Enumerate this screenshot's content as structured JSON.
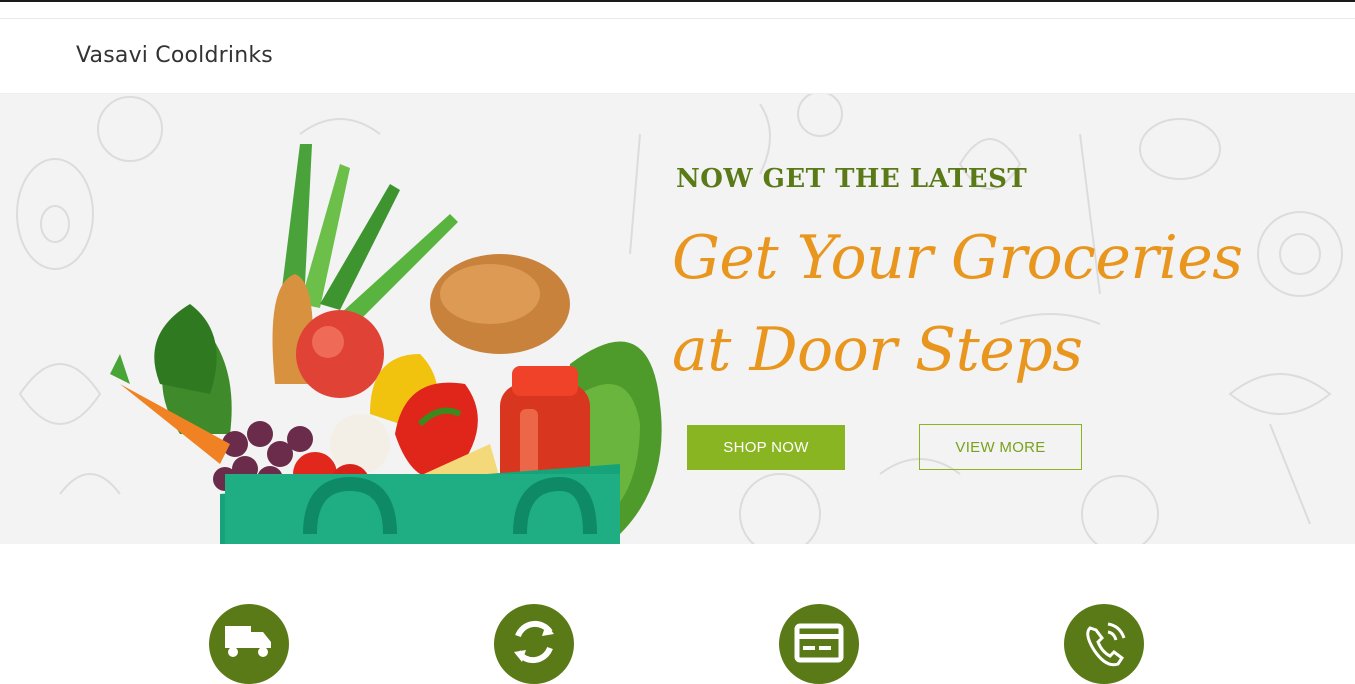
{
  "header": {
    "brand": "Vasavi Cooldrinks"
  },
  "hero": {
    "eyebrow": "NOW GET THE LATEST",
    "headline_line1": "Get Your Groceries",
    "headline_line2": "at Door Steps",
    "primary_button": "SHOP NOW",
    "secondary_button": "VIEW MORE"
  },
  "features": [
    {
      "icon": "delivery-truck-icon"
    },
    {
      "icon": "refresh-icon"
    },
    {
      "icon": "credit-card-icon"
    },
    {
      "icon": "phone-support-icon"
    }
  ],
  "colors": {
    "brand_green": "#5a7a17",
    "accent_green": "#8ab522",
    "headline_orange": "#e9961f"
  }
}
